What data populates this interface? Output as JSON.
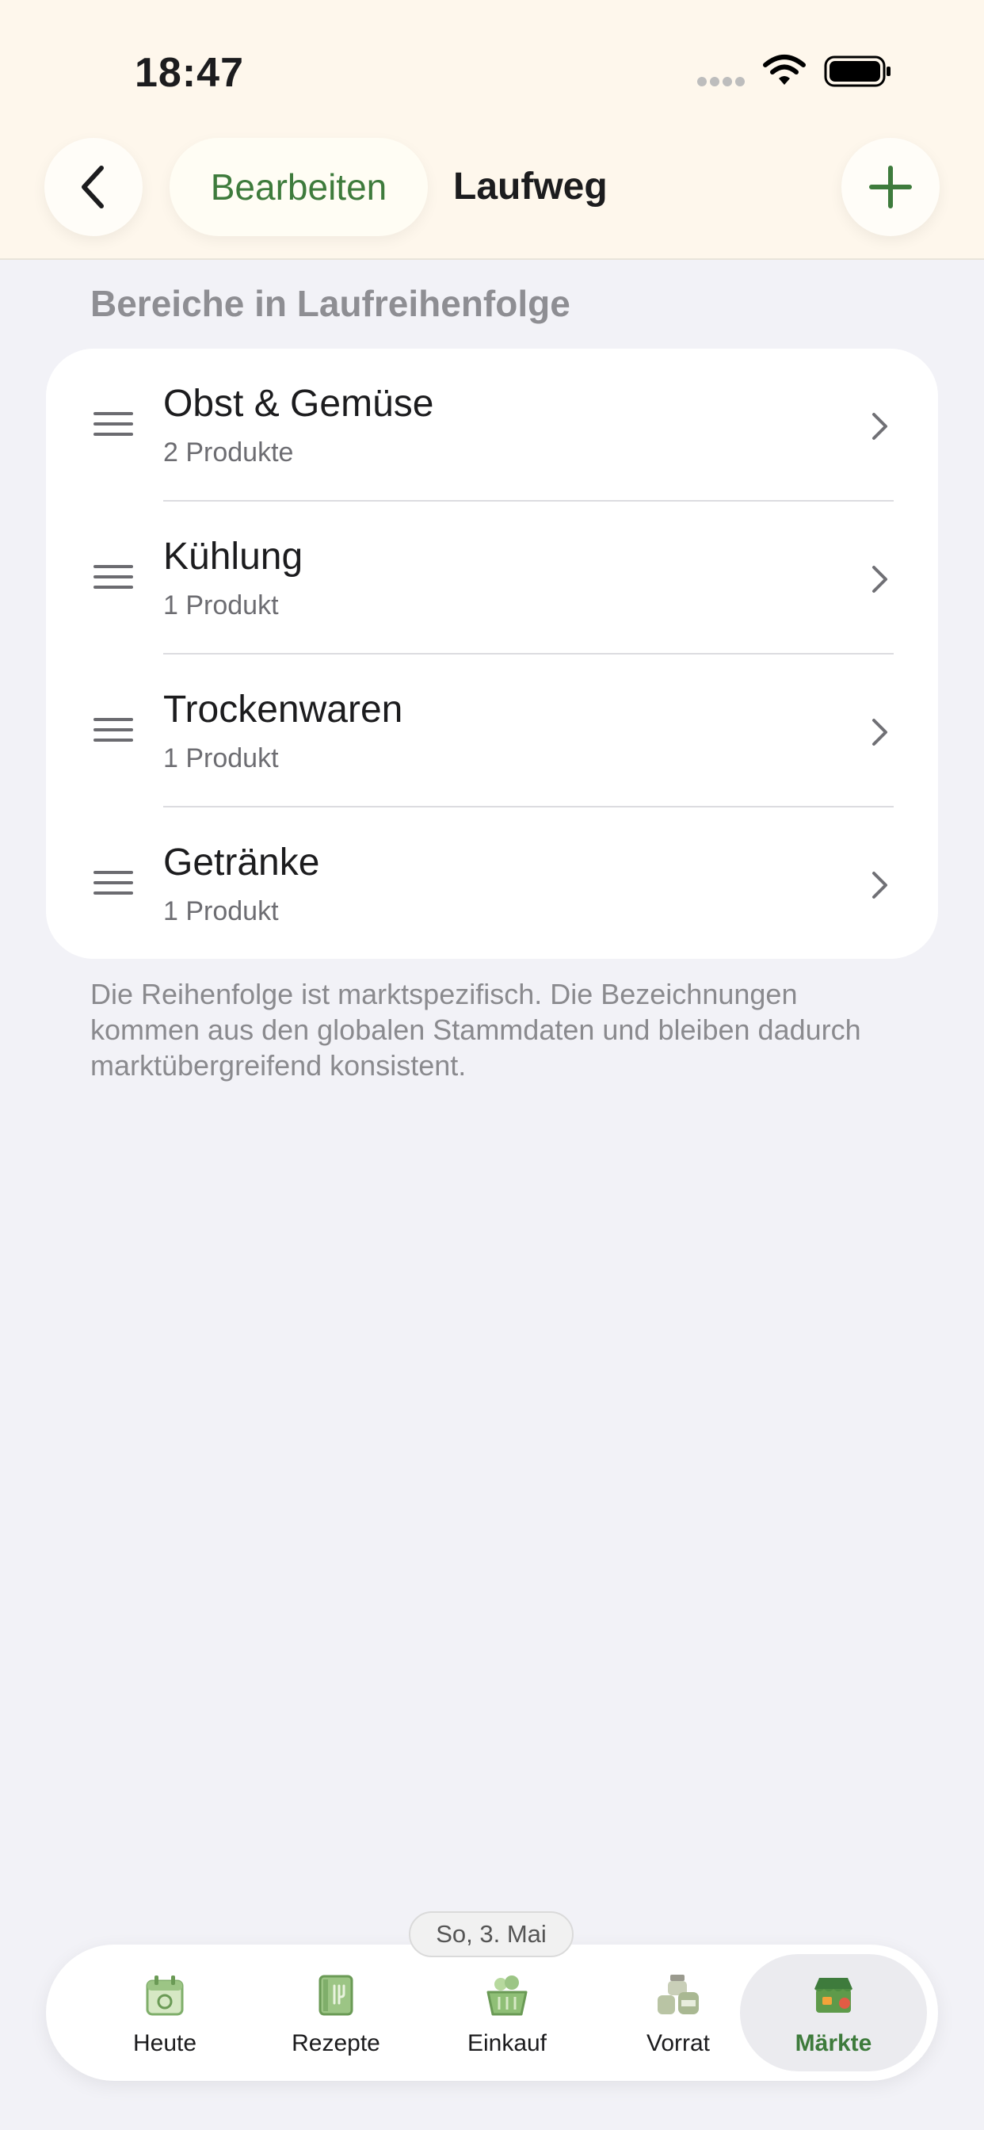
{
  "status_bar": {
    "time": "18:47"
  },
  "nav": {
    "edit_label": "Bearbeiten",
    "title": "Laufweg"
  },
  "section": {
    "title": "Bereiche in Laufreihenfolge",
    "items": [
      {
        "name": "Obst & Gemüse",
        "count": "2 Produkte"
      },
      {
        "name": "Kühlung",
        "count": "1 Produkt"
      },
      {
        "name": "Trockenwaren",
        "count": "1 Produkt"
      },
      {
        "name": "Getränke",
        "count": "1 Produkt"
      }
    ],
    "footnote": "Die Reihenfolge ist marktspezifisch. Die Bezeichnungen kommen aus den globalen Stammdaten und bleiben dadurch marktübergreifend konsistent."
  },
  "date_badge": "So, 3. Mai",
  "tabs": [
    {
      "label": "Heute",
      "icon": "calendar-icon"
    },
    {
      "label": "Rezepte",
      "icon": "recipe-book-icon"
    },
    {
      "label": "Einkauf",
      "icon": "basket-icon"
    },
    {
      "label": "Vorrat",
      "icon": "jars-icon"
    },
    {
      "label": "Märkte",
      "icon": "store-icon",
      "active": true
    }
  ],
  "colors": {
    "accent": "#3E7B3C",
    "header_bg": "#FEF7EC",
    "page_bg": "#F2F2F7"
  }
}
